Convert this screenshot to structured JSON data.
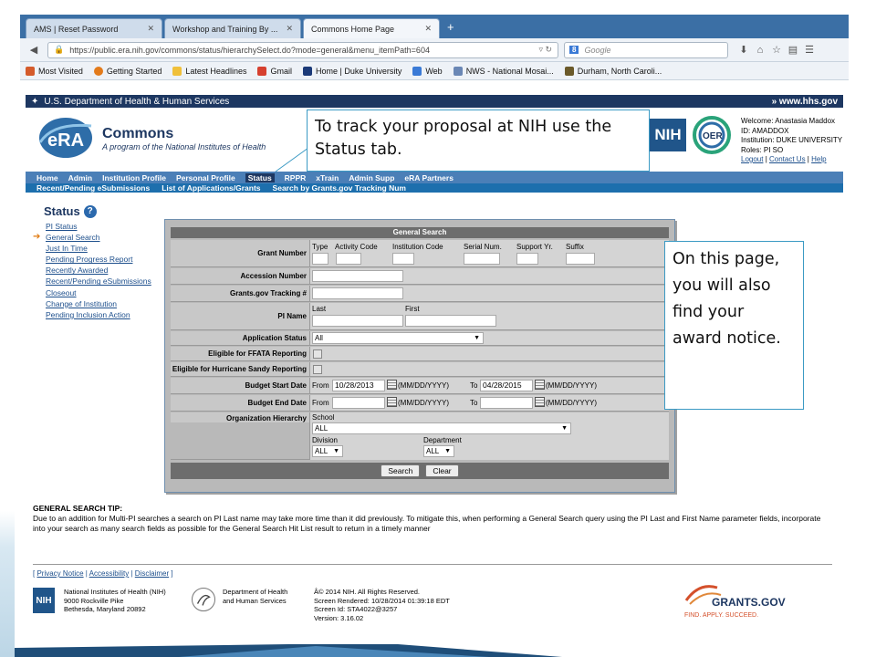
{
  "browser": {
    "tabs": [
      {
        "title": "AMS | Reset Password",
        "active": false
      },
      {
        "title": "Workshop and Training By ...",
        "active": false
      },
      {
        "title": "Commons Home Page",
        "active": true
      }
    ],
    "url": "https://public.era.nih.gov/commons/status/hierarchySelect.do?mode=general&menu_itemPath=604",
    "search_placeholder": "Google",
    "bookmarks": [
      "Most Visited",
      "Getting Started",
      "Latest Headlines",
      "Gmail",
      "Home | Duke University",
      "Web",
      "NWS - National Mosai...",
      "Durham, North Caroli..."
    ]
  },
  "hhs_bar": {
    "left": "U.S. Department of Health & Human Services",
    "right": "www.hhs.gov"
  },
  "era": {
    "title": "Commons",
    "subtitle": "A program of the National Institutes of Health",
    "logo": "eRA",
    "nih_logo": "NIH",
    "oer_logo": "OER"
  },
  "user": {
    "welcome": "Welcome: Anastasia Maddox",
    "id": "ID: AMADDOX",
    "institution": "Institution: DUKE UNIVERSITY",
    "roles": "Roles: PI SO",
    "links": [
      "Logout",
      "Contact Us",
      "Help"
    ]
  },
  "menu_main": [
    "Home",
    "Admin",
    "Institution Profile",
    "Personal Profile",
    "Status",
    "RPPR",
    "xTrain",
    "Admin Supp",
    "eRA Partners"
  ],
  "menu_sub": [
    "Recent/Pending eSubmissions",
    "List of Applications/Grants",
    "Search by Grants.gov Tracking Num"
  ],
  "left_nav": {
    "title": "Status",
    "items": [
      "PI Status",
      "General Search",
      "Just In Time",
      "Pending Progress Report",
      "Recently Awarded",
      "Recent/Pending eSubmissions",
      "Closeout",
      "Change of Institution",
      "Pending Inclusion Action"
    ],
    "current_index": 1
  },
  "form": {
    "title": "General Search",
    "grant_number": {
      "label": "Grant Number",
      "fields": [
        "Type",
        "Activity Code",
        "Institution Code",
        "Serial Num.",
        "Support Yr.",
        "Suffix"
      ]
    },
    "accession": {
      "label": "Accession Number"
    },
    "tracking": {
      "label": "Grants.gov Tracking #"
    },
    "pi_name": {
      "label": "PI Name",
      "last": "Last",
      "first": "First"
    },
    "app_status": {
      "label": "Application Status",
      "value": "All"
    },
    "ffata": {
      "label": "Eligible for FFATA Reporting"
    },
    "sandy": {
      "label": "Eligible for Hurricane Sandy Reporting"
    },
    "budget_start": {
      "label": "Budget Start Date",
      "from_label": "From",
      "from": "10/28/2013",
      "fmt": "(MM/DD/YYYY)",
      "to_label": "To",
      "to": "04/28/2015"
    },
    "budget_end": {
      "label": "Budget End Date",
      "from_label": "From",
      "from": "",
      "fmt": "(MM/DD/YYYY)",
      "to_label": "To",
      "to": ""
    },
    "org": {
      "label": "Organization Hierarchy",
      "school_label": "School",
      "school": "ALL",
      "division_label": "Division",
      "division": "ALL",
      "dept_label": "Department",
      "dept": "ALL"
    },
    "buttons": {
      "search": "Search",
      "clear": "Clear"
    }
  },
  "callouts": {
    "status": "To track your proposal at NIH use the Status tab.",
    "award": "On this page, you will also find your award notice."
  },
  "tip": {
    "title": "GENERAL SEARCH TIP:",
    "text": "Due to an addition for Multi-PI searches a search on PI Last name may take more time than it did previously. To mitigate this, when performing a General Search query using the PI Last and First Name parameter fields, incorporate into your search as many search fields as possible for the General Search Hit List result to return in a timely manner"
  },
  "footer": {
    "links": [
      "Privacy Notice",
      "Accessibility",
      "Disclaimer"
    ],
    "nih": "NIH",
    "nih_address": [
      "National Institutes of Health (NIH)",
      "9000 Rockville Pike",
      "Bethesda, Maryland 20892"
    ],
    "dept": [
      "Department of Health",
      "and Human Services"
    ],
    "copyright": [
      "Â© 2014 NIH. All Rights Reserved.",
      "Screen Rendered: 10/28/2014 01:39:18 EDT",
      "Screen Id: STA4022@3257",
      "Version: 3.16.02"
    ],
    "grants_logo": "GRANTS.GOV",
    "grants_tagline": "FIND. APPLY. SUCCEED."
  },
  "colors": {
    "navy": "#1d3761",
    "menu_blue": "#4b7fb7",
    "submenu_blue": "#1d6fad",
    "callout_border": "#3b9ac4",
    "link": "#1d4f8c"
  }
}
